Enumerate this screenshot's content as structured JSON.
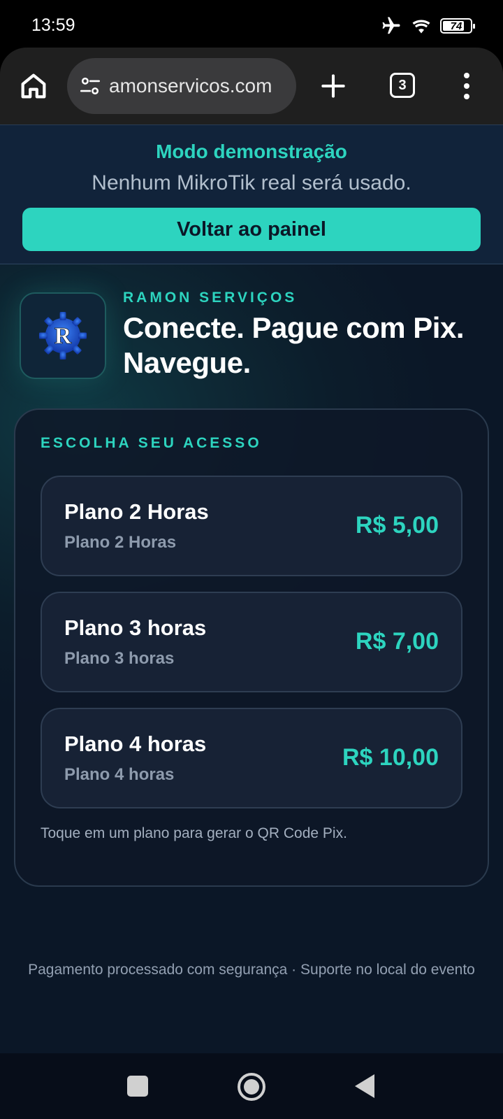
{
  "status_bar": {
    "time": "13:59",
    "battery": "74",
    "icons": [
      "airplane-icon",
      "wifi-icon",
      "battery-icon"
    ]
  },
  "browser": {
    "url": "amonservicos.com",
    "tab_count": "3",
    "icons": [
      "home-icon",
      "site-settings-icon",
      "plus-icon",
      "tabs-icon",
      "more-vert-icon"
    ]
  },
  "demo": {
    "title": "Modo demonstração",
    "subtitle": "Nenhum MikroTik real será usado.",
    "back_label": "Voltar ao painel"
  },
  "brand": {
    "logo_letter": "R",
    "name": "RAMON SERVIÇOS",
    "headline": "Conecte. Pague com Pix. Navegue."
  },
  "access": {
    "title": "ESCOLHA SEU ACESSO",
    "plans": [
      {
        "name": "Plano 2 Horas",
        "description": "Plano 2 Horas",
        "price": "R$ 5,00"
      },
      {
        "name": "Plano 3 horas",
        "description": "Plano 3 horas",
        "price": "R$ 7,00"
      },
      {
        "name": "Plano 4 horas",
        "description": "Plano 4 horas",
        "price": "R$ 10,00"
      }
    ],
    "hint": "Toque em um plano para gerar o QR Code Pix."
  },
  "footer": {
    "note": "Pagamento processado com segurança · Suporte no local do evento"
  },
  "colors": {
    "accent": "#2dd4bf",
    "background": "#0b1727",
    "card": "#172235"
  }
}
